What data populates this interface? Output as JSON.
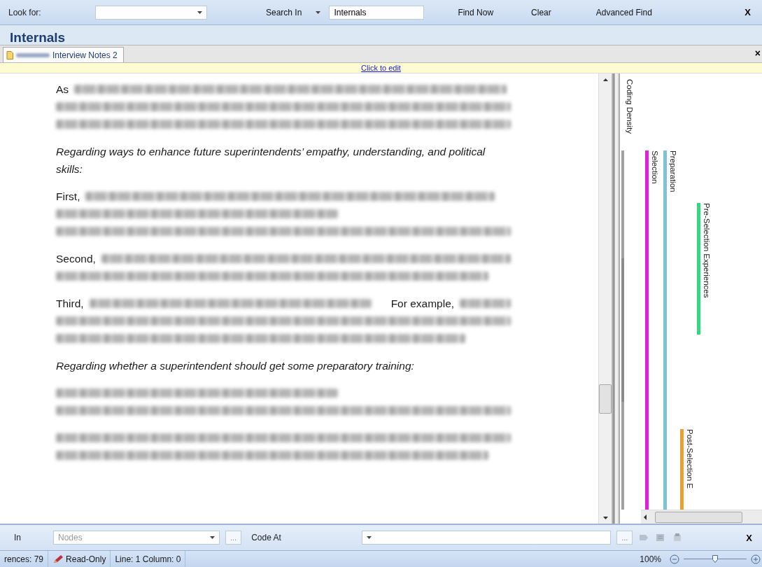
{
  "search_bar": {
    "look_for_label": "Look for:",
    "search_in": "Search In",
    "scope": "Internals",
    "buttons": [
      "Find Now",
      "Clear",
      "Advanced Find"
    ],
    "close": "X"
  },
  "title": "Internals",
  "tabs": [
    {
      "label": "Interview Notes 2",
      "selected": true
    }
  ],
  "tab_close": "×",
  "edit_bar": {
    "link": "Click to edit"
  },
  "document": {
    "paragraphs": [
      {
        "kind": "blurred",
        "lines": [
          {
            "kind": "lead",
            "lead": "As"
          },
          {
            "kind": "blur"
          },
          {
            "kind": "blur"
          }
        ]
      },
      {
        "kind": "italic",
        "text": "Regarding ways to enhance future superintendents’ empathy, understanding, and political skills:"
      },
      {
        "kind": "blurred",
        "lines": [
          {
            "kind": "lead",
            "lead": "First,"
          },
          {
            "kind": "blur"
          },
          {
            "kind": "blur"
          }
        ]
      },
      {
        "kind": "blurred",
        "lines": [
          {
            "kind": "lead",
            "lead": "Second,"
          },
          {
            "kind": "blur"
          }
        ]
      },
      {
        "kind": "blurred",
        "lines": [
          {
            "kind": "lead",
            "lead": "Third,",
            "mid": "For example,"
          },
          {
            "kind": "blur"
          },
          {
            "kind": "blur"
          }
        ]
      },
      {
        "kind": "italic",
        "text": "Regarding whether a superintendent should get some preparatory training:"
      },
      {
        "kind": "blurred",
        "lines": [
          {
            "kind": "blur"
          },
          {
            "kind": "blur"
          }
        ]
      },
      {
        "kind": "blurred",
        "lines": [
          {
            "kind": "blur"
          },
          {
            "kind": "blur"
          }
        ]
      }
    ]
  },
  "coding_stripes": {
    "density_label": "Coding Density",
    "stripes": [
      {
        "label": "Selection",
        "color": "#e020e0"
      },
      {
        "label": "Preparation",
        "color": "#80c0d8"
      },
      {
        "label": "Pre-Selection Experiences",
        "color": "#30d880"
      },
      {
        "label": "Post-Selection E",
        "color": "#e8a030"
      }
    ]
  },
  "code_bar": {
    "in_label": "In",
    "nodes_placeholder": "Nodes",
    "browse": "...",
    "code_at_label": "Code At",
    "browse_2": "...",
    "close": "X"
  },
  "status_bar": {
    "references": "rences: 79",
    "read_only": "Read-Only",
    "position": "Line: 1 Column: 0",
    "zoom": "100%",
    "zoom_level": {
      "level": 0.5
    }
  }
}
